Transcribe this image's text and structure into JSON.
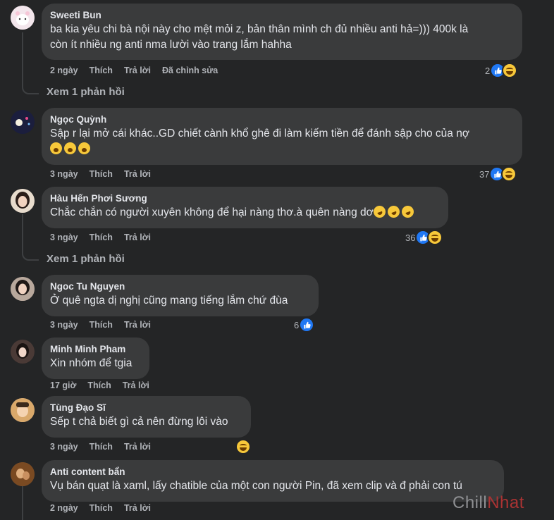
{
  "comments": [
    {
      "author": "Sweeti Bun",
      "text": "ba kia yêu chi bà nội này cho mệt mỏi z, bản thân mình ch đủ nhiều anti hả=))) 400k là\ncòn ít nhiều ng anti nma lười vào trang lắm hahha",
      "time": "2 ngày",
      "like": "Thích",
      "reply": "Trả lời",
      "edited": "Đã chỉnh sửa",
      "reactions": "2",
      "view_replies": "Xem 1 phản hồi"
    },
    {
      "author": "Ngọc Quỳnh",
      "text": "Sập r lại mở cái khác..GD chiết cành khổ ghê đi làm kiếm tiền để đánh sập cho của nợ",
      "time": "3 ngày",
      "like": "Thích",
      "reply": "Trả lời",
      "reactions": "37"
    },
    {
      "author": "Hàu Hến Phơi Sương",
      "text": "Chắc chắn có người xuyên không để hại nàng thơ.à quên nàng dơ",
      "time": "3 ngày",
      "like": "Thích",
      "reply": "Trả lời",
      "reactions": "36",
      "view_replies": "Xem 1 phản hồi"
    },
    {
      "author": "Ngoc Tu Nguyen",
      "text": "Ở quê ngta dị nghị cũng mang tiếng lắm chứ đùa",
      "time": "3 ngày",
      "like": "Thích",
      "reply": "Trả lời",
      "reactions": "6"
    },
    {
      "author": "Minh Minh Pham",
      "text": "Xin nhóm để tgia",
      "time": "17 giờ",
      "like": "Thích",
      "reply": "Trả lời"
    },
    {
      "author": "Tùng Đạo Sĩ",
      "text": "Sếp t chả biết gì cả nên đừng lôi vào",
      "time": "3 ngày",
      "like": "Thích",
      "reply": "Trả lời"
    },
    {
      "author": "Anti content bẩn",
      "text": "Vụ bán quạt là xaml, lấy chatible của một con người Pin, đã xem clip và đ phải con tú",
      "time": "2 ngày",
      "like": "Thích",
      "reply": "Trả lời"
    }
  ],
  "watermark": {
    "part1": "Chill",
    "part2": "Nhat"
  },
  "colors": {
    "background": "#242526",
    "bubble": "#3a3b3c",
    "like_blue": "#2078f4",
    "haha_yellow": "#f7c83a"
  }
}
